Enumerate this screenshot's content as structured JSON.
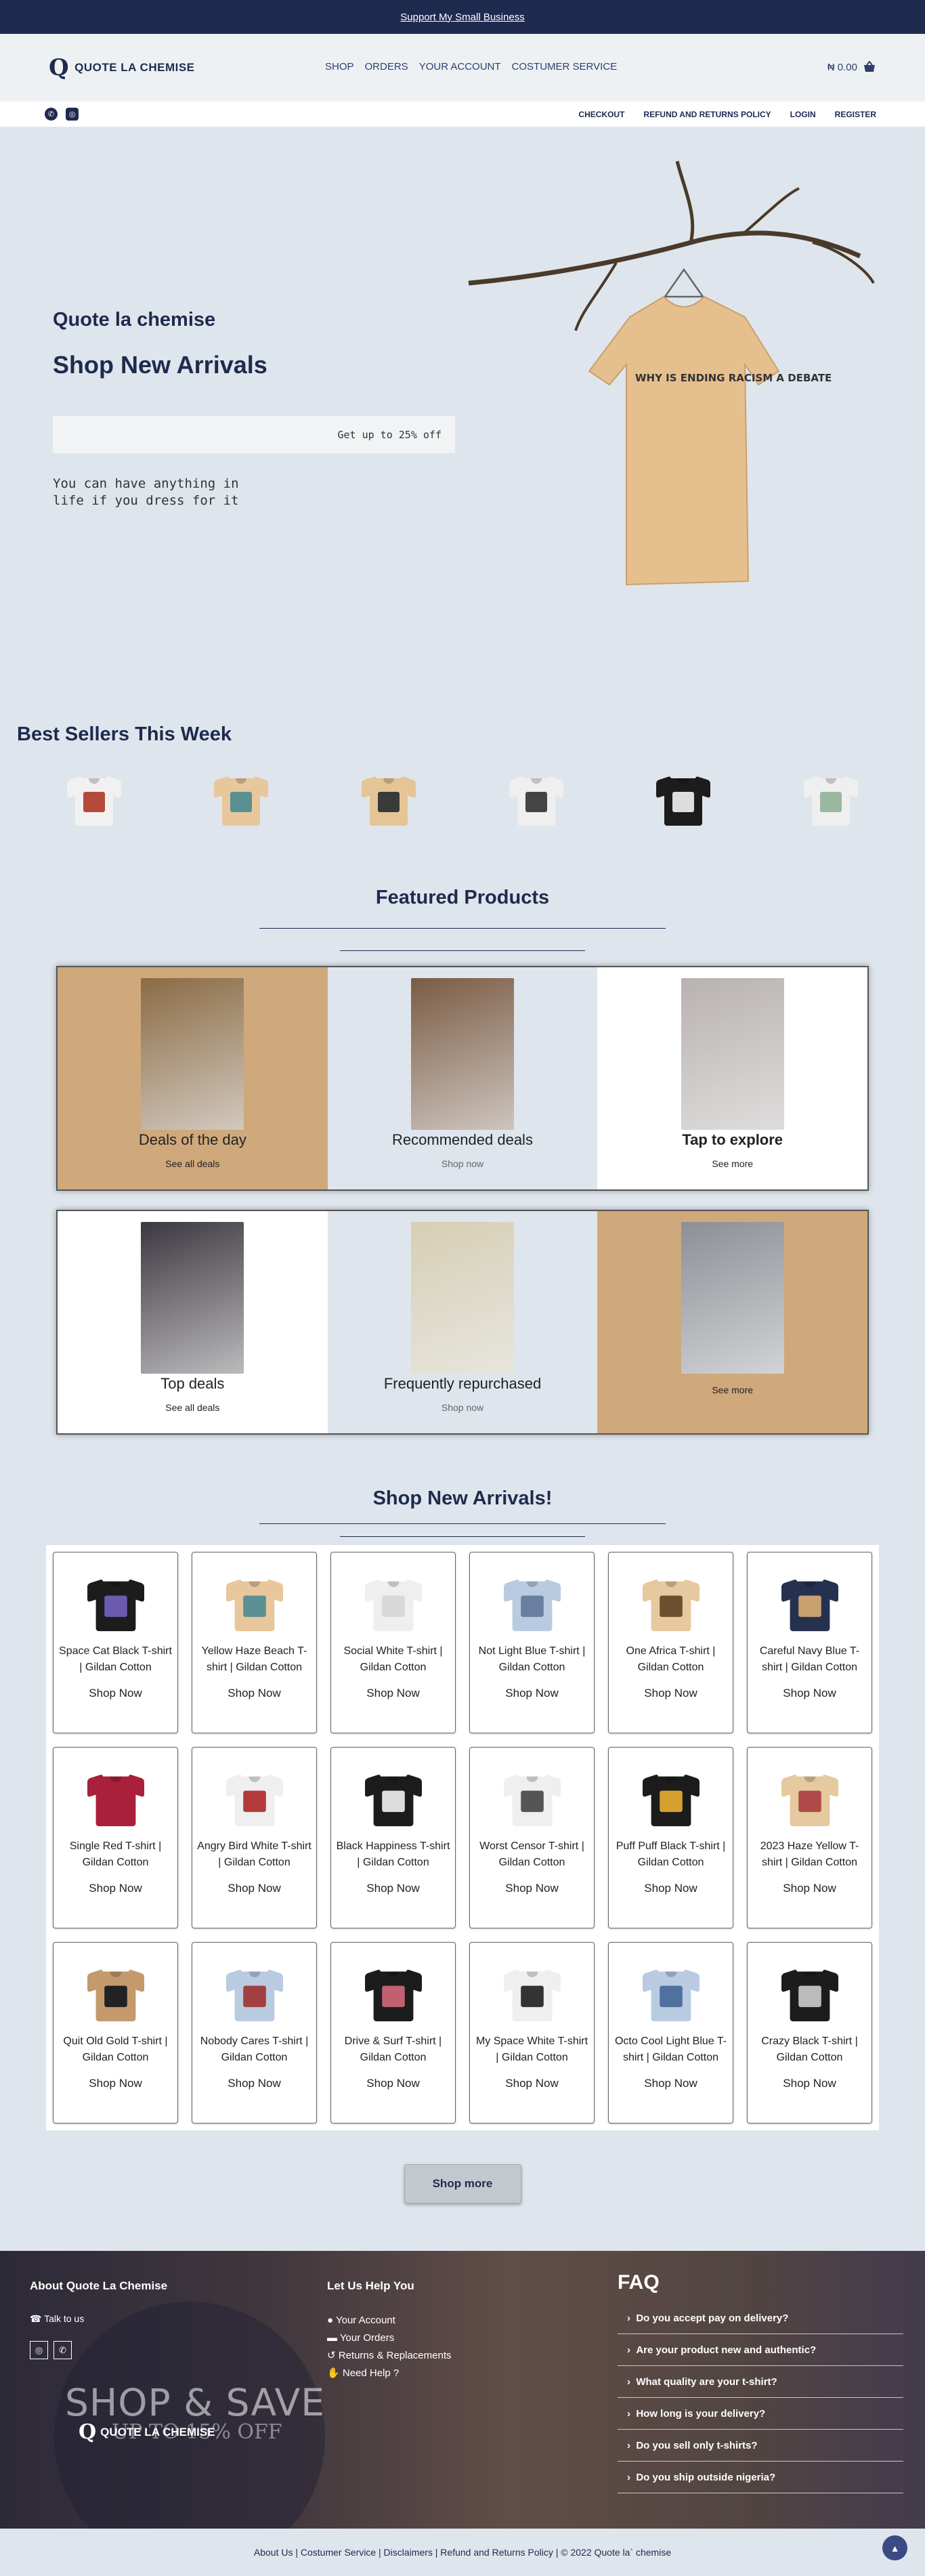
{
  "topbar": {
    "link": "Support My Small Business"
  },
  "header": {
    "logo_text": "QUOTE LA CHEMISE",
    "nav": [
      "SHOP",
      "ORDERS",
      "YOUR ACCOUNT",
      "COSTUMER SERVICE"
    ],
    "cart_total": "₦ 0.00"
  },
  "subbar": {
    "links": [
      "CHECKOUT",
      "REFUND AND RETURNS POLICY",
      "LOGIN",
      "REGISTER"
    ]
  },
  "hero": {
    "brand": "Quote la chemise",
    "title": "Shop New Arrivals",
    "deal": "Get up to 25% off",
    "tagline": "You can have anything in life if you dress for it",
    "shirt_print": "WHY IS ENDING RACISM A DEBATE"
  },
  "best": {
    "title": "Best Sellers This Week",
    "items": [
      {
        "color": "#f1f1f1",
        "print": "#b44a3a"
      },
      {
        "color": "#e7c79b",
        "print": "#5a8f93"
      },
      {
        "color": "#e5c595",
        "print": "#3a3a3a"
      },
      {
        "color": "#efefef",
        "print": "#444444"
      },
      {
        "color": "#1c1c1c",
        "print": "#dddddd"
      },
      {
        "color": "#efefef",
        "print": "#9ab8a0"
      }
    ]
  },
  "featured": {
    "title": "Featured Products",
    "row1": [
      {
        "caption": "Deals of the day",
        "action": "See all deals",
        "bg": "#cfa97c",
        "img": "#8b6b45"
      },
      {
        "caption": "Recommended deals",
        "action": "Shop now",
        "bg": "#dfe5ec",
        "img": "#7b5c44"
      },
      {
        "caption": "Tap to explore",
        "action": "See more",
        "bg": "#ffffff",
        "img": "#b8b2b0"
      }
    ],
    "row2": [
      {
        "caption": "Top deals",
        "action": "See all deals",
        "bg": "#ffffff",
        "img": "#3c3840"
      },
      {
        "caption": "Frequently repurchased",
        "action": "Shop now",
        "bg": "#dfe5ec",
        "img": "#d6cfb4"
      },
      {
        "caption": "",
        "action": "See more",
        "bg": "#cfa97c",
        "img": "#8c8f96"
      }
    ]
  },
  "arrivals": {
    "title": "Shop New Arrivals!",
    "cta": "Shop Now",
    "products": [
      {
        "name": "Space Cat Black T-shirt | Gildan Cotton",
        "color": "#1c1c1c",
        "print": "#6a5ab0"
      },
      {
        "name": "Yellow Haze Beach T-shirt | Gildan Cotton",
        "color": "#e7c79b",
        "print": "#5a8f93"
      },
      {
        "name": "Social White T-shirt | Gildan Cotton",
        "color": "#efefef",
        "print": "#d8d8d8"
      },
      {
        "name": "Not Light Blue T-shirt | Gildan Cotton",
        "color": "#b9cbe0",
        "print": "#6a7fa0"
      },
      {
        "name": "One Africa T-shirt | Gildan Cotton",
        "color": "#e6c99e",
        "print": "#6b5030"
      },
      {
        "name": "Careful Navy Blue T-shirt | Gildan Cotton",
        "color": "#26304f",
        "print": "#c8a070"
      },
      {
        "name": "Single Red T-shirt | Gildan Cotton",
        "color": "#a8203a",
        "print": "#a8203a"
      },
      {
        "name": "Angry Bird White T-shirt | Gildan Cotton",
        "color": "#efefef",
        "print": "#b43a3a"
      },
      {
        "name": "Black Happiness T-shirt | Gildan Cotton",
        "color": "#1c1c1c",
        "print": "#dddddd"
      },
      {
        "name": "Worst Censor T-shirt | Gildan Cotton",
        "color": "#efefef",
        "print": "#555555"
      },
      {
        "name": "Puff Puff Black T-shirt | Gildan Cotton",
        "color": "#1c1c1c",
        "print": "#d4a030"
      },
      {
        "name": "2023 Haze Yellow T-shirt | Gildan Cotton",
        "color": "#e6c99e",
        "print": "#b04a4a"
      },
      {
        "name": "Quit Old Gold T-shirt | Gildan Cotton",
        "color": "#c49a6c",
        "print": "#222222"
      },
      {
        "name": "Nobody Cares T-shirt | Gildan Cotton",
        "color": "#b9cbe0",
        "print": "#a04040"
      },
      {
        "name": "Drive & Surf T-shirt | Gildan Cotton",
        "color": "#1c1c1c",
        "print": "#c06070"
      },
      {
        "name": "My Space White T-shirt | Gildan Cotton",
        "color": "#efefef",
        "print": "#333333"
      },
      {
        "name": "Octo Cool Light Blue T-shirt | Gildan Cotton",
        "color": "#b9cbe0",
        "print": "#5070a0"
      },
      {
        "name": "Crazy Black T-shirt | Gildan Cotton",
        "color": "#1c1c1c",
        "print": "#bbbbbb"
      }
    ],
    "more": "Shop more"
  },
  "footer": {
    "about_title": "About Quote La Chemise",
    "talk": "Talk to us",
    "shop_save": "SHOP & SAVE",
    "up_to": "UP TO 15% OFF",
    "help_title": "Let Us Help You",
    "help": [
      "Your Account",
      "Your Orders",
      "Returns & Replacements",
      "Need Help ?"
    ],
    "faq_title": "FAQ",
    "faq": [
      "Do you accept pay on delivery?",
      "Are your product new and authentic?",
      "What quality are your t-shirt?",
      "How long is your delivery?",
      "Do you sell only t-shirts?",
      "Do you ship outside nigeria?"
    ],
    "bottom": "About Us | Costumer Service | Disclaimers  | Refund and Returns Policy  |   © 2022 Quote la` chemise"
  }
}
